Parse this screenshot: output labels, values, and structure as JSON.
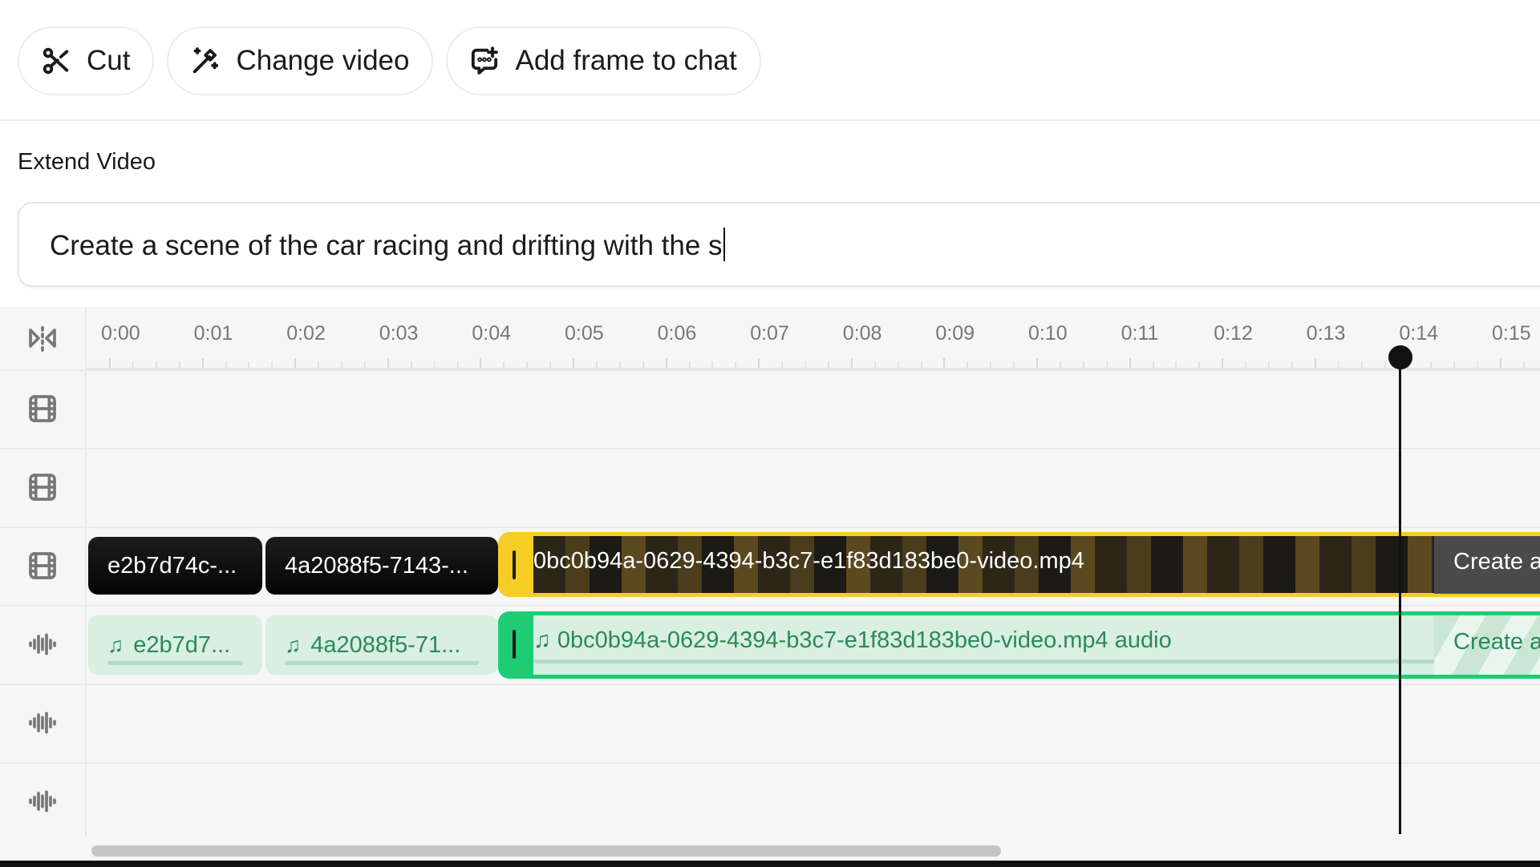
{
  "toolbar": {
    "buttons": [
      {
        "label": "Cut",
        "icon": "scissors-icon"
      },
      {
        "label": "Change video",
        "icon": "magic-wand-icon"
      },
      {
        "label": "Add frame to chat",
        "icon": "chat-add-icon"
      }
    ]
  },
  "extend": {
    "label": "Extend Video",
    "prompt_value": "Create a scene of the car racing and drifting with the s"
  },
  "timeline": {
    "ruler": [
      "0:00",
      "0:01",
      "0:02",
      "0:03",
      "0:04",
      "0:05",
      "0:06",
      "0:07",
      "0:08",
      "0:09",
      "0:10",
      "0:11",
      "0:12",
      "0:13",
      "0:14",
      "0:15"
    ],
    "playhead_time_seconds": 14.2,
    "track_icons": [
      "snap-icon",
      "film-icon",
      "film-icon",
      "film-icon",
      "waveform-icon",
      "waveform-icon",
      "waveform-icon"
    ],
    "video_clips": [
      {
        "label": "e2b7d74c-..."
      },
      {
        "label": "4a2088f5-7143-..."
      }
    ],
    "selected_video_clip": {
      "label": "0bc0b94a-0629-4394-b3c7-e1f83d183be0-video.mp4"
    },
    "pending_video_clip": {
      "label": "Create a"
    },
    "audio_clips": [
      {
        "label": "e2b7d7..."
      },
      {
        "label": "4a2088f5-71..."
      }
    ],
    "selected_audio_clip": {
      "label": "0bc0b94a-0629-4394-b3c7-e1f83d183be0-video.mp4 audio"
    },
    "pending_audio_clip": {
      "label": "Create a"
    }
  },
  "colors": {
    "selected_video_border": "#f5cd24",
    "selected_audio_border": "#1fcc73",
    "audio_text": "#2b8a57"
  }
}
